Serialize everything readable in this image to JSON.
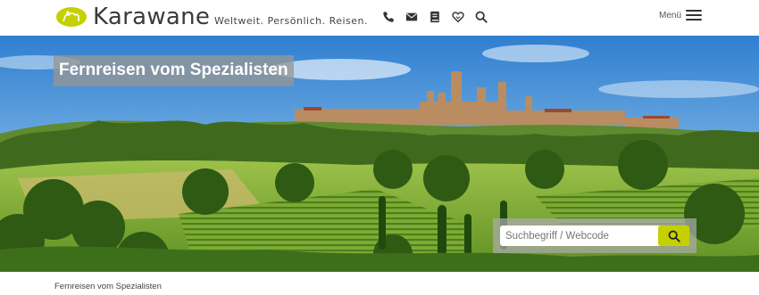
{
  "header": {
    "brand": "Karawane",
    "tagline": "Weltweit. Persönlich. Reisen.",
    "icons": [
      "phone-icon",
      "mail-icon",
      "catalog-icon",
      "heart-icon",
      "search-icon"
    ],
    "menu_label": "Menü"
  },
  "hero": {
    "title": "Fernreisen vom Spezialisten",
    "search_placeholder": "Suchbegriff / Webcode"
  },
  "breadcrumb": {
    "current": "Fernreisen vom Spezialisten"
  },
  "colors": {
    "brand_green": "#c5d000",
    "text_dark": "#333333"
  }
}
